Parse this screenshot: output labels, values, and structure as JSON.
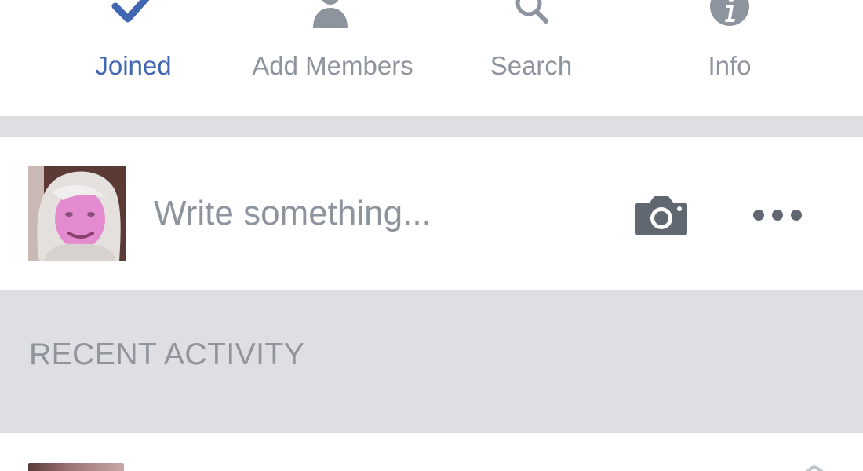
{
  "actions": {
    "joined": {
      "label": "Joined",
      "icon": "check-icon",
      "active": true
    },
    "add_members": {
      "label": "Add Members",
      "icon": "add-person-icon"
    },
    "search": {
      "label": "Search",
      "icon": "search-icon"
    },
    "info": {
      "label": "Info",
      "icon": "info-icon"
    }
  },
  "composer": {
    "placeholder": "Write something...",
    "camera_icon": "camera-icon",
    "more_icon": "more-dots-icon"
  },
  "section": {
    "title": "RECENT ACTIVITY"
  },
  "colors": {
    "accent": "#4267b2",
    "muted_text": "#8d949e",
    "icon_gray": "#606770",
    "band": "#dddfe2"
  }
}
